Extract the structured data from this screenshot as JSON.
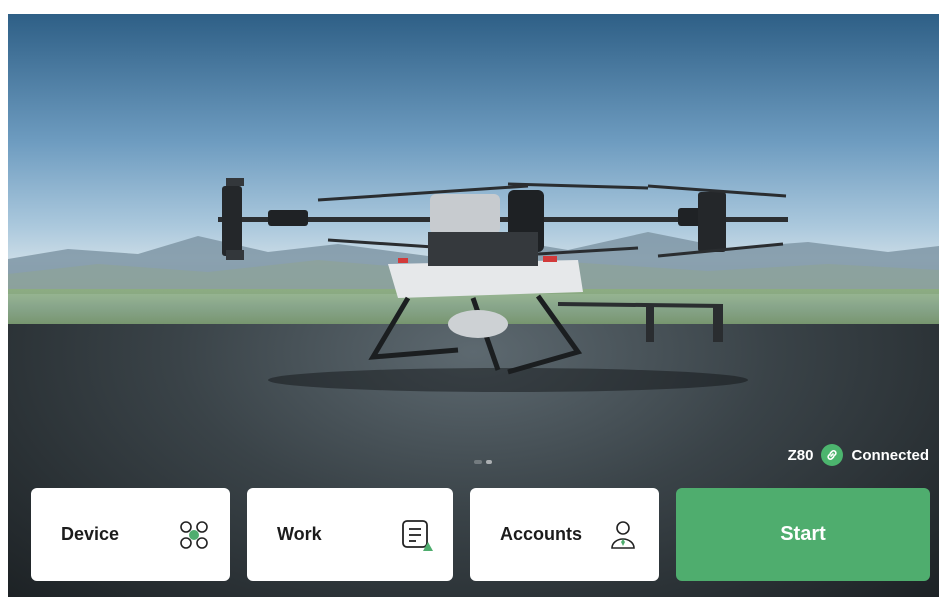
{
  "status": {
    "model": "Z80",
    "connection": "Connected",
    "link_icon": "link-icon",
    "accent": "#4cb56e"
  },
  "menu": {
    "device_label": "Device",
    "device_icon": "drone-icon",
    "work_label": "Work",
    "work_icon": "task-list-icon",
    "accounts_label": "Accounts",
    "accounts_icon": "user-icon",
    "start_label": "Start",
    "start_color": "#4fad6e"
  },
  "carousel": {
    "pages": 2,
    "active": 1
  }
}
